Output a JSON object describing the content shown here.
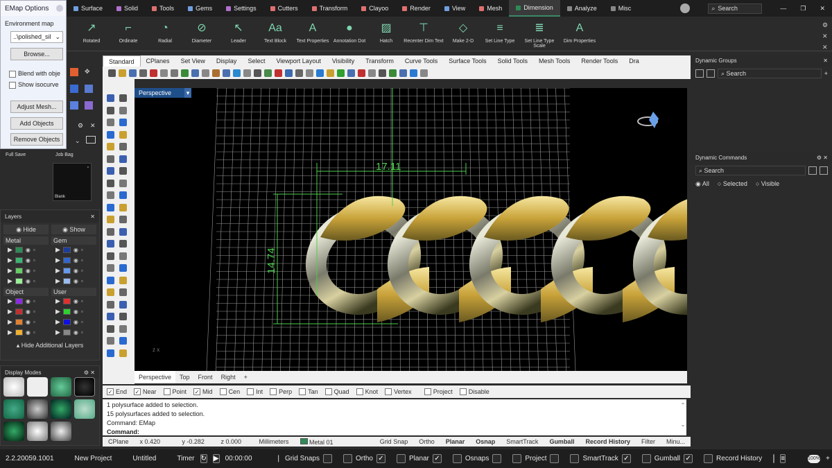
{
  "menubar": {
    "app": "EMap Options",
    "tabs": [
      {
        "label": "Surface",
        "color": "#6fa0e0"
      },
      {
        "label": "Solid",
        "color": "#b070d0"
      },
      {
        "label": "Tools",
        "color": "#e07070"
      },
      {
        "label": "Gems",
        "color": "#70a0e0"
      },
      {
        "label": "Settings",
        "color": "#b070d0"
      },
      {
        "label": "Cutters",
        "color": "#e07070"
      },
      {
        "label": "Transform",
        "color": "#e07070"
      },
      {
        "label": "Clayoo",
        "color": "#e07070"
      },
      {
        "label": "Render",
        "color": "#e07070"
      },
      {
        "label": "View",
        "color": "#70a0e0"
      },
      {
        "label": "Mesh",
        "color": "#e07070"
      },
      {
        "label": "Dimension",
        "color": "#2e8b57"
      },
      {
        "label": "Analyze",
        "color": "#888"
      },
      {
        "label": "Misc",
        "color": "#888"
      }
    ],
    "search": "Search"
  },
  "ribbon": [
    {
      "label": "Rotated",
      "glyph": "↗"
    },
    {
      "label": "Ordinate",
      "glyph": "⌐"
    },
    {
      "label": "Radial",
      "glyph": "◔"
    },
    {
      "label": "Diameter",
      "glyph": "⊘"
    },
    {
      "label": "Leader",
      "glyph": "↖"
    },
    {
      "label": "Text Block",
      "glyph": "Aa"
    },
    {
      "label": "Text Properties",
      "glyph": "A"
    },
    {
      "label": "Annotation Dot",
      "glyph": "●"
    },
    {
      "label": "Hatch",
      "glyph": "▨"
    },
    {
      "label": "Recenter Dim Text",
      "glyph": "⊤"
    },
    {
      "label": "Make 2-D",
      "glyph": "◇"
    },
    {
      "label": "Set Line Type",
      "glyph": "≡"
    },
    {
      "label": "Set Line Type Scale",
      "glyph": "≣"
    },
    {
      "label": "Dim Properties",
      "glyph": "A"
    }
  ],
  "emap": {
    "title": "EMap Options",
    "env": "Environment map",
    "file": "..\\polished_sil",
    "browse": "Browse...",
    "blend": "Blend with obje",
    "iso": "Show isocurve",
    "adjust": "Adjust Mesh...",
    "add": "Add Objects",
    "remove": "Remove Objects"
  },
  "left": {
    "fullsave": "Full Save",
    "jobbag": "Job Bag",
    "blank": "Blank"
  },
  "layers": {
    "title": "Layers",
    "hide": "Hide",
    "show": "Show",
    "metal": "Metal",
    "gem": "Gem",
    "object": "Object",
    "user": "User",
    "hideadd": "Hide Additional Layers",
    "metal_colors": [
      "#2e8b57",
      "#3cb371",
      "#66cc66",
      "#99ee99"
    ],
    "gem_colors": [
      "#1e3c9a",
      "#3366cc",
      "#6699ee",
      "#99bbee"
    ],
    "object_colors": [
      "#8a2be2",
      "#c03030",
      "#e08030",
      "#f0b030"
    ],
    "user_colors": [
      "#e03030",
      "#30d030",
      "#1010e0",
      "#888888"
    ]
  },
  "displaymodes": {
    "title": "Display Modes"
  },
  "toolbar": {
    "tabs": [
      "Standard",
      "CPlanes",
      "Set View",
      "Display",
      "Select",
      "Viewport Layout",
      "Visibility",
      "Transform",
      "Curve Tools",
      "Surface Tools",
      "Solid Tools",
      "Mesh Tools",
      "Render Tools",
      "Dra"
    ]
  },
  "viewport": {
    "title": "Perspective",
    "dim_h": "17.11",
    "dim_v": "14.74",
    "axis": "z x",
    "tabs": [
      "Perspective",
      "Top",
      "Front",
      "Right"
    ]
  },
  "osnap": {
    "items": [
      {
        "label": "End",
        "on": true
      },
      {
        "label": "Near",
        "on": true
      },
      {
        "label": "Point",
        "on": false
      },
      {
        "label": "Mid",
        "on": true
      },
      {
        "label": "Cen",
        "on": false
      },
      {
        "label": "Int",
        "on": false
      },
      {
        "label": "Perp",
        "on": false
      },
      {
        "label": "Tan",
        "on": false
      },
      {
        "label": "Quad",
        "on": false
      },
      {
        "label": "Knot",
        "on": false
      },
      {
        "label": "Vertex",
        "on": false
      },
      {
        "label": "Project",
        "on": false
      },
      {
        "label": "Disable",
        "on": false
      }
    ]
  },
  "cmd": {
    "l1": "1 polysurface added to selection.",
    "l2": "15 polysurfaces added to selection.",
    "l3": "Command: EMap",
    "prompt": "Command:"
  },
  "status": {
    "cplane": "CPlane",
    "x": "x 0.420",
    "y": "y -0.282",
    "z": "z 0.000",
    "units": "Millimeters",
    "layer": "Metal 01",
    "items": [
      "Grid Snap",
      "Ortho",
      "Planar",
      "Osnap",
      "SmartTrack",
      "Gumball",
      "Record History",
      "Filter",
      "Minu..."
    ]
  },
  "right": {
    "groups": "Dynamic Groups",
    "commands": "Dynamic Commands",
    "search": "Search",
    "all": "All",
    "selected": "Selected",
    "visible": "Visible"
  },
  "bottom": {
    "version": "2.2.20059.1001",
    "newproject": "New Project",
    "untitled": "Untitled",
    "timer": "Timer",
    "time": "00:00:00",
    "gridsnaps": "Grid Snaps",
    "ortho": "Ortho",
    "planar": "Planar",
    "osnaps": "Osnaps",
    "project": "Project",
    "smarttrack": "SmartTrack",
    "gumball": "Gumball",
    "history": "Record History",
    "zoom": "100%"
  }
}
